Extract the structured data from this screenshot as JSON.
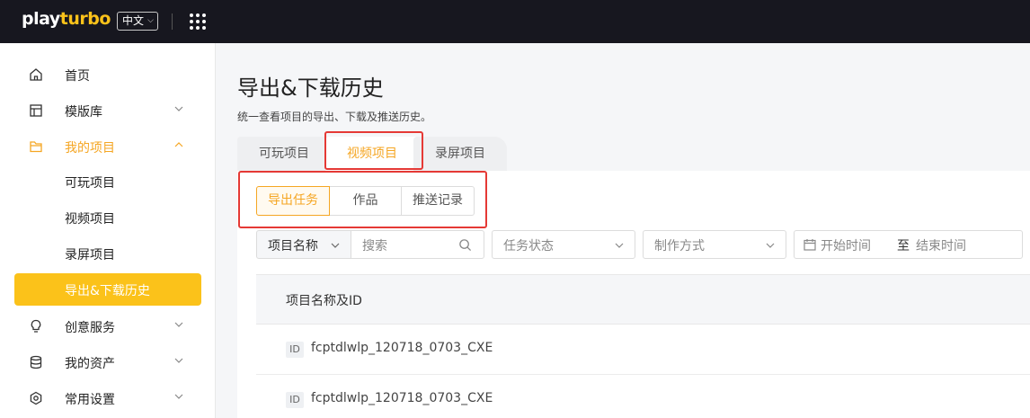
{
  "topbar": {
    "logo_main": "play",
    "logo_accent": "turbo",
    "language": "中文",
    "apps_icon": "grid-icon"
  },
  "sidebar": {
    "items": [
      {
        "label": "首页",
        "icon": "home-icon"
      },
      {
        "label": "模版库",
        "icon": "template-icon",
        "expandable": true
      },
      {
        "label": "我的项目",
        "icon": "folder-icon",
        "expandable": true,
        "expanded": true
      },
      {
        "label": "可玩项目"
      },
      {
        "label": "视频项目"
      },
      {
        "label": "录屏项目"
      },
      {
        "label": "导出&下载历史",
        "selected": true
      },
      {
        "label": "创意服务",
        "icon": "bulb-icon",
        "expandable": true
      },
      {
        "label": "我的资产",
        "icon": "database-icon",
        "expandable": true
      },
      {
        "label": "常用设置",
        "icon": "settings-icon",
        "expandable": true
      }
    ]
  },
  "main": {
    "title": "导出&下载历史",
    "description": "统一查看项目的导出、下载及推送历史。",
    "tabs": [
      {
        "label": "可玩项目"
      },
      {
        "label": "视频项目",
        "active": true
      },
      {
        "label": "录屏项目"
      }
    ],
    "segments": [
      {
        "label": "导出任务",
        "active": true
      },
      {
        "label": "作品"
      },
      {
        "label": "推送记录"
      }
    ],
    "filters": {
      "field_select": "项目名称",
      "search_placeholder": "搜索",
      "status_placeholder": "任务状态",
      "method_placeholder": "制作方式",
      "start_placeholder": "开始时间",
      "range_separator": "至",
      "end_placeholder": "结束时间"
    },
    "table": {
      "columns": [
        "项目名称及ID"
      ],
      "rows": [
        {
          "id_tag": "ID",
          "name": "fcptdlwlp_120718_0703_CXE"
        },
        {
          "id_tag": "ID",
          "name": "fcptdlwlp_120718_0703_CXE"
        }
      ]
    }
  },
  "colors": {
    "accent": "#fbc21a",
    "accent_text": "#f5a623",
    "topbar": "#17171f",
    "highlight_box": "#e53935"
  }
}
